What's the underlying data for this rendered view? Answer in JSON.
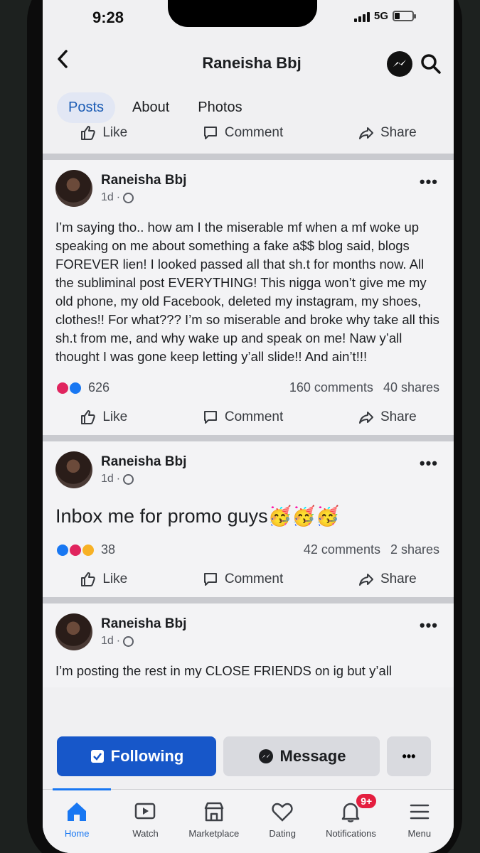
{
  "status": {
    "time": "9:28",
    "network": "5G"
  },
  "header": {
    "title": "Raneisha Bbj"
  },
  "tabs": [
    {
      "label": "Posts",
      "active": true
    },
    {
      "label": "About",
      "active": false
    },
    {
      "label": "Photos",
      "active": false
    }
  ],
  "actions": {
    "like": "Like",
    "comment": "Comment",
    "share": "Share"
  },
  "posts": [
    {
      "author": "Raneisha Bbj",
      "time": "1d",
      "text": "I’m saying tho.. how am I the miserable mf when a mf woke up speaking on me about something a fake a$$ blog said, blogs FOREVER lien! I looked passed all that sh.t for months now. All the subliminal post EVERYTHING! This nigga won’t give me my old phone, my old Facebook, deleted my instagram, my shoes, clothes!! For what??? I’m so miserable and broke why take all this sh.t from me, and why wake up and speak on me! Naw y’all thought I was gone keep letting y’all slide!! And ain’t!!!",
      "reactions": "626",
      "comments": "160 comments",
      "shares": "40 shares"
    },
    {
      "author": "Raneisha Bbj",
      "time": "1d",
      "text": "Inbox me for promo guys🥳🥳🥳",
      "reactions": "38",
      "comments": "42 comments",
      "shares": "2 shares"
    },
    {
      "author": "Raneisha Bbj",
      "time": "1d",
      "text": "I’m posting the rest in my CLOSE FRIENDS on ig but y’all"
    }
  ],
  "profile_buttons": {
    "following": "Following",
    "message": "Message"
  },
  "tabbar": {
    "items": [
      {
        "label": "Home",
        "icon": "home-icon"
      },
      {
        "label": "Watch",
        "icon": "watch-icon"
      },
      {
        "label": "Marketplace",
        "icon": "marketplace-icon"
      },
      {
        "label": "Dating",
        "icon": "dating-icon"
      },
      {
        "label": "Notifications",
        "icon": "bell-icon"
      },
      {
        "label": "Menu",
        "icon": "menu-icon"
      }
    ],
    "notifications_badge": "9+"
  },
  "colors": {
    "accent": "#1877f2",
    "following_button": "#1757c9",
    "badge": "#e41e3f"
  }
}
